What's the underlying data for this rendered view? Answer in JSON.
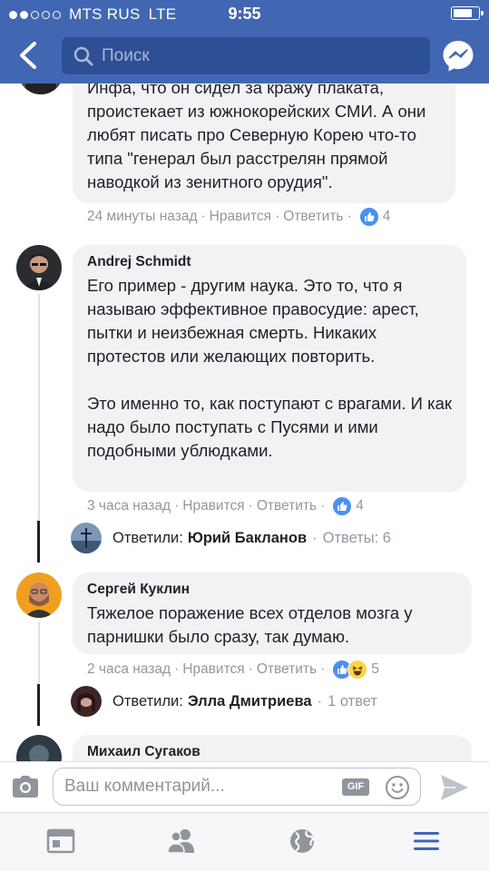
{
  "status_bar": {
    "carrier": "MTS RUS",
    "network": "LTE",
    "time": "9:55"
  },
  "header": {
    "search_placeholder": "Поиск",
    "icons": [
      "back-arrow-icon",
      "search-icon",
      "messenger-icon"
    ]
  },
  "comments": [
    {
      "author": "",
      "text": "Инфа, что он сидел за кражу плаката, проистекает из южнокорейских СМИ. А они любят писать про Северную Корею что-то типа \"генерал был расстрелян прямой наводкой из зенитного орудия\".",
      "time": "24 минуты назад",
      "like_label": "Нравится",
      "reply_label": "Ответить",
      "reactions": [
        "like"
      ],
      "reaction_count": "4"
    },
    {
      "author": "Andrej Schmidt",
      "text": "Его пример - другим наука. Это то, что я называю эффективное правосудие: арест, пытки и неизбежная смерть. Никаких протестов или желающих повторить.\n\nЭто именно то, как поступают с врагами. И как надо было поступать с Пусями и ими подобными ублюдками.",
      "time": "3 часа назад",
      "like_label": "Нравится",
      "reply_label": "Ответить",
      "reactions": [
        "like"
      ],
      "reaction_count": "4",
      "replies": {
        "label": "Ответили:",
        "name": "Юрий Бакланов",
        "count_text": "Ответы: 6"
      }
    },
    {
      "author": "Сергей Куклин",
      "text": "Тяжелое поражение всех отделов мозга у парнишки было сразу, так думаю.",
      "time": "2 часа назад",
      "like_label": "Нравится",
      "reply_label": "Ответить",
      "reactions": [
        "like",
        "haha"
      ],
      "reaction_count": "5",
      "replies": {
        "label": "Ответили:",
        "name": "Элла Дмитриева",
        "count_text": "1 ответ"
      }
    },
    {
      "author": "Михаил Сугаков"
    }
  ],
  "composer": {
    "placeholder": "Ваш комментарий...",
    "gif_label": "GIF"
  },
  "bottom_nav": {
    "items": [
      "news-feed-icon",
      "friends-icon",
      "globe-icon",
      "menu-icon"
    ]
  },
  "colors": {
    "brand": "#4267b2",
    "search_bg": "#2d4f94",
    "bubble": "#f1f2f4",
    "meta_text": "#9197a3",
    "like_blue": "#4a90f0",
    "active_nav": "#4267b2"
  }
}
